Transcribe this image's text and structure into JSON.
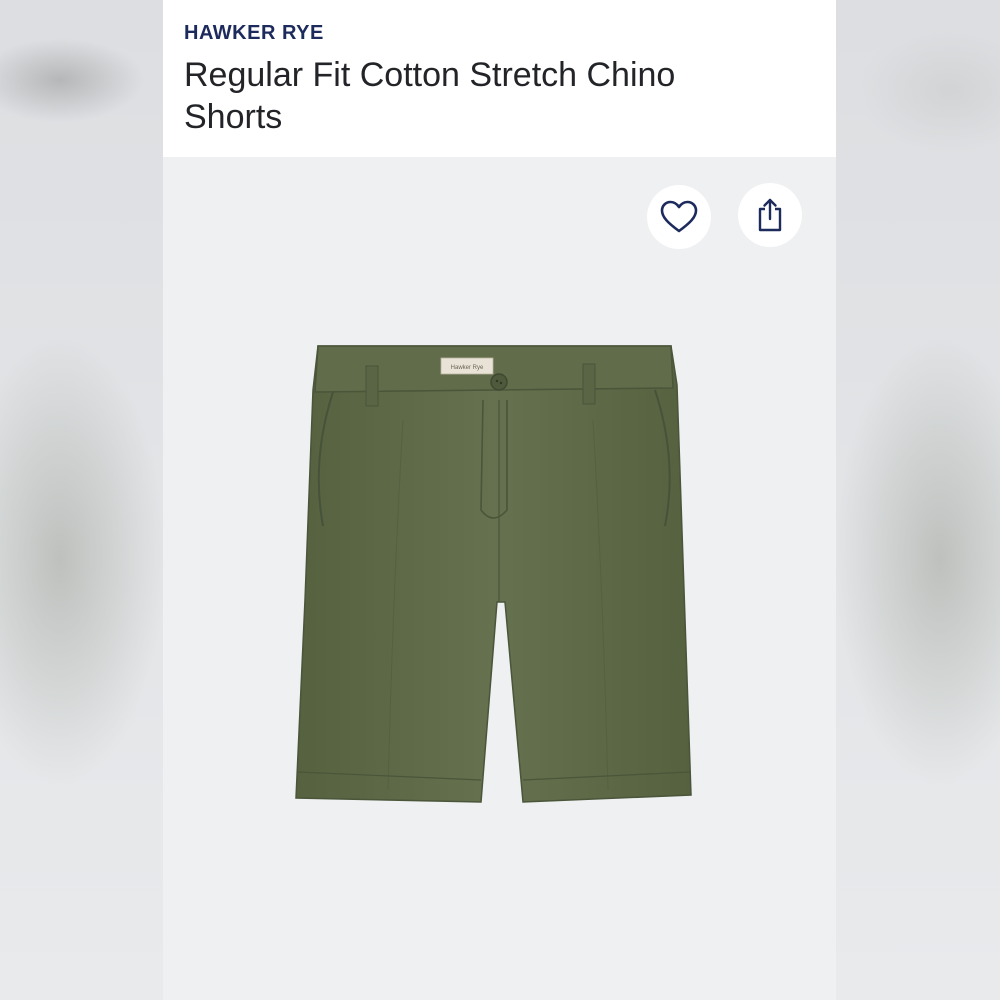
{
  "product": {
    "brand": "HAWKER RYE",
    "title": "Regular Fit Cotton Stretch Chino Shorts",
    "image_alt": "Olive green chino shorts",
    "garment_color": "#5e6b4a",
    "waist_tag_text": "Hawker Rye"
  },
  "actions": {
    "favorite_icon": "heart-outline",
    "share_icon": "share-up-arrow"
  },
  "colors": {
    "brand_text": "#1d2a5c",
    "title_text": "#222428",
    "image_background": "#eef0f2"
  }
}
